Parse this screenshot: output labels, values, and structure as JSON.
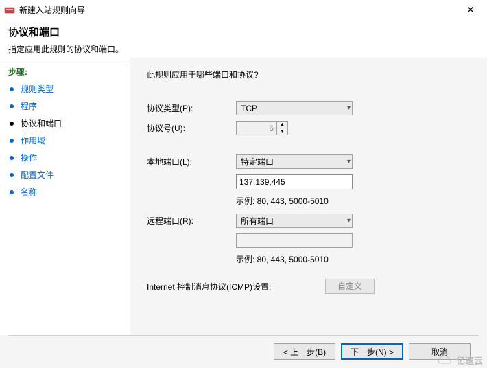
{
  "window": {
    "title": "新建入站规则向导"
  },
  "header": {
    "title": "协议和端口",
    "subtitle": "指定应用此规则的协议和端口。"
  },
  "sidebar": {
    "heading": "步骤:",
    "steps": [
      {
        "label": "规则类型",
        "current": false
      },
      {
        "label": "程序",
        "current": false
      },
      {
        "label": "协议和端口",
        "current": true
      },
      {
        "label": "作用域",
        "current": false
      },
      {
        "label": "操作",
        "current": false
      },
      {
        "label": "配置文件",
        "current": false
      },
      {
        "label": "名称",
        "current": false
      }
    ]
  },
  "content": {
    "heading": "此规则应用于哪些端口和协议?",
    "protocol_type_label": "协议类型(P):",
    "protocol_type_value": "TCP",
    "protocol_number_label": "协议号(U):",
    "protocol_number_value": "6",
    "local_port_label": "本地端口(L):",
    "local_port_select": "特定端口",
    "local_port_value": "137,139,445",
    "remote_port_label": "远程端口(R):",
    "remote_port_select": "所有端口",
    "example_text": "示例: 80, 443, 5000-5010",
    "icmp_label": "Internet 控制消息协议(ICMP)设置:",
    "icmp_button": "自定义"
  },
  "footer": {
    "back": "< 上一步(B)",
    "next": "下一步(N) >",
    "cancel": "取消"
  },
  "watermark": "亿速云"
}
